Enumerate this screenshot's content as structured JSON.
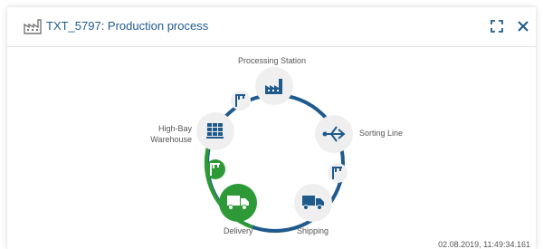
{
  "window": {
    "title": "TXT_5797: Production process",
    "icons": {
      "app": "factory-icon",
      "expand": "expand-icon",
      "close": "close-icon"
    }
  },
  "process": {
    "stations": {
      "processing": {
        "label": "Processing Station",
        "icon": "factory-icon"
      },
      "sorting": {
        "label": "Sorting Line",
        "icon": "sorting-arrows-icon"
      },
      "shipping": {
        "label": "Shipping",
        "icon": "truck-icon"
      },
      "delivery": {
        "label": "Delivery",
        "icon": "truck-icon",
        "status": "active"
      },
      "warehouse": {
        "label_line1": "High-Bay",
        "label_line2": "Warehouse",
        "icon": "shelves-icon"
      }
    },
    "connectors": [
      "crane-icon",
      "crane-icon",
      "crane-icon"
    ]
  },
  "timestamp": "02.08.2019, 11:49:34.161",
  "colors": {
    "accent": "#1f5a8c",
    "active": "#2e9a37",
    "node_bg": "#efefef"
  }
}
